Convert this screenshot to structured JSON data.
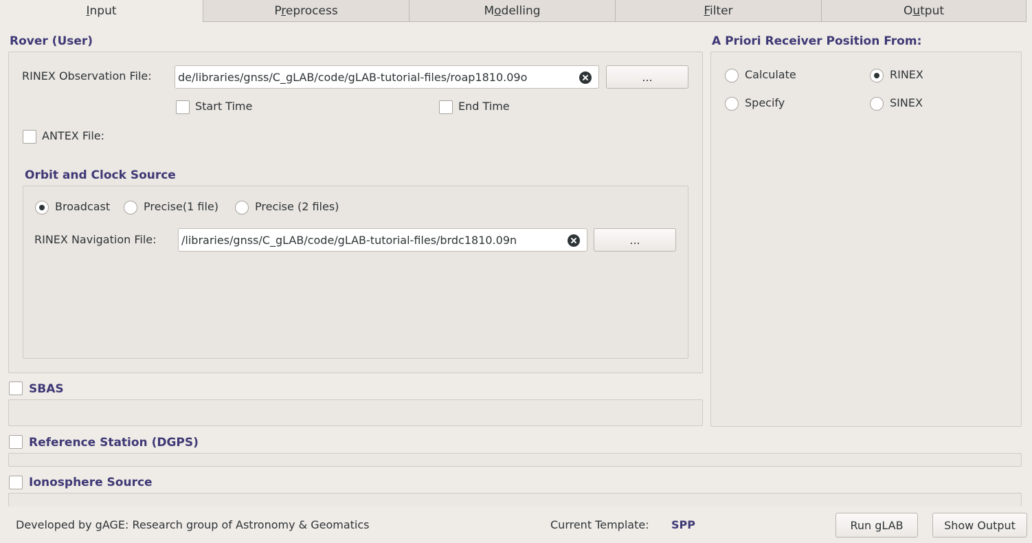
{
  "tabs": [
    {
      "label": "Input",
      "mnemonic_index": 0
    },
    {
      "label": "Preprocess",
      "mnemonic_index": 1
    },
    {
      "label": "Modelling",
      "mnemonic_index": 1
    },
    {
      "label": "Filter",
      "mnemonic_index": 0
    },
    {
      "label": "Output",
      "mnemonic_index": 1
    }
  ],
  "active_tab": "Input",
  "rover": {
    "title": "Rover (User)",
    "obs_label": "RINEX Observation File:",
    "obs_value": "de/libraries/gnss/C_gLAB/code/gLAB-tutorial-files/roap1810.09o",
    "browse_label": "...",
    "start_time_label": "Start Time",
    "end_time_label": "End Time",
    "antex_label": "ANTEX File:"
  },
  "orbit": {
    "title": "Orbit and Clock Source",
    "options": [
      "Broadcast",
      "Precise(1 file)",
      "Precise (2 files)"
    ],
    "selected": "Broadcast",
    "nav_label": "RINEX Navigation File:",
    "nav_value": "/libraries/gnss/C_gLAB/code/gLAB-tutorial-files/brdc1810.09n",
    "browse_label": "..."
  },
  "apriori": {
    "title": "A Priori Receiver Position From:",
    "options": [
      "Calculate",
      "RINEX",
      "Specify",
      "SINEX"
    ],
    "selected": "RINEX"
  },
  "sbas": {
    "title": "SBAS"
  },
  "reference": {
    "title": "Reference Station (DGPS)"
  },
  "ionosphere": {
    "title": "Ionosphere Source"
  },
  "footer": {
    "credits": "Developed by gAGE: Research group of Astronomy & Geomatics",
    "template_label": "Current Template:",
    "template_value": "SPP",
    "run_label": "Run gLAB",
    "show_output_label": "Show Output"
  }
}
